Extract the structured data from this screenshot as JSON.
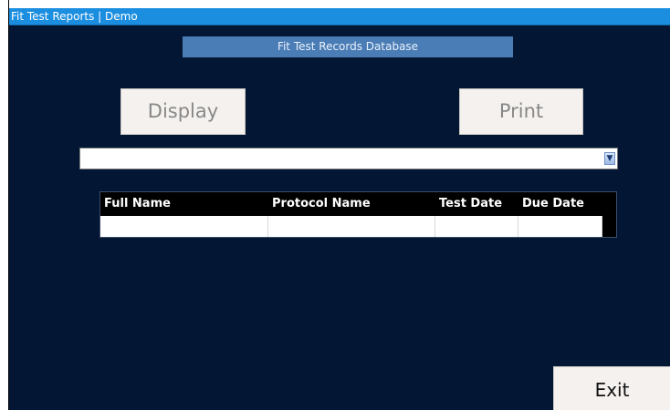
{
  "window": {
    "title": "Fit Test Reports | Demo"
  },
  "header": {
    "database_title": "Fit Test Records Database"
  },
  "buttons": {
    "display": "Display",
    "print": "Print",
    "exit": "Exit"
  },
  "record_select": {
    "value": ""
  },
  "table": {
    "columns": [
      "Full Name",
      "Protocol Name",
      "Test Date",
      "Due Date"
    ],
    "rows": [
      [
        "",
        "",
        "",
        ""
      ]
    ]
  },
  "colors": {
    "background": "#031735",
    "titlebar": "#1b8ee0",
    "header_bar": "#4a7db5",
    "button_face": "#f4f1ee"
  }
}
